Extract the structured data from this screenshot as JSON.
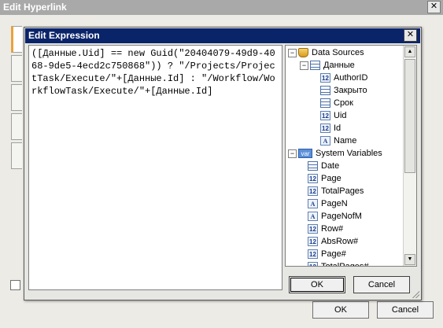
{
  "outer": {
    "title": "Edit Hyperlink",
    "close_glyph": "✕",
    "ok_label": "OK",
    "cancel_label": "Cancel"
  },
  "dialog": {
    "title": "Edit Expression",
    "close_glyph": "✕",
    "expression": "([Данные.Uid] == new Guid(\"20404079-49d9-4068-9de5-4ecd2c750868\")) ? \"/Projects/ProjectTask/Execute/\"+[Данные.Id] : \"/Workflow/WorkflowTask/Execute/\"+[Данные.Id]",
    "ok_label": "OK",
    "cancel_label": "Cancel"
  },
  "tree": {
    "data_sources": {
      "label": "Data Sources",
      "expander": "−",
      "icon": "database-icon",
      "children": [
        {
          "label": "Данные",
          "expander": "−",
          "icon": "table-icon",
          "fields": [
            {
              "label": "AuthorID",
              "icon": "numeric-field-icon",
              "glyph": "12"
            },
            {
              "label": "Закрыто",
              "icon": "boolean-field-icon",
              "glyph": ""
            },
            {
              "label": "Срок",
              "icon": "date-field-icon",
              "glyph": ""
            },
            {
              "label": "Uid",
              "icon": "numeric-field-icon",
              "glyph": "12"
            },
            {
              "label": "Id",
              "icon": "numeric-field-icon",
              "glyph": "12"
            },
            {
              "label": "Name",
              "icon": "text-field-icon",
              "glyph": "A"
            }
          ]
        }
      ]
    },
    "system_variables": {
      "label": "System Variables",
      "expander": "−",
      "icon_text": "var",
      "items": [
        {
          "label": "Date",
          "icon": "date-field-icon",
          "glyph": ""
        },
        {
          "label": "Page",
          "icon": "numeric-field-icon",
          "glyph": "12"
        },
        {
          "label": "TotalPages",
          "icon": "numeric-field-icon",
          "glyph": "12"
        },
        {
          "label": "PageN",
          "icon": "text-field-icon",
          "glyph": "A"
        },
        {
          "label": "PageNofM",
          "icon": "text-field-icon",
          "glyph": "A"
        },
        {
          "label": "Row#",
          "icon": "numeric-field-icon",
          "glyph": "12"
        },
        {
          "label": "AbsRow#",
          "icon": "numeric-field-icon",
          "glyph": "12"
        },
        {
          "label": "Page#",
          "icon": "numeric-field-icon",
          "glyph": "12"
        },
        {
          "label": "TotalPages#",
          "icon": "numeric-field-icon",
          "glyph": "12"
        }
      ]
    },
    "scroll_up_glyph": "▲",
    "scroll_down_glyph": "▼"
  }
}
